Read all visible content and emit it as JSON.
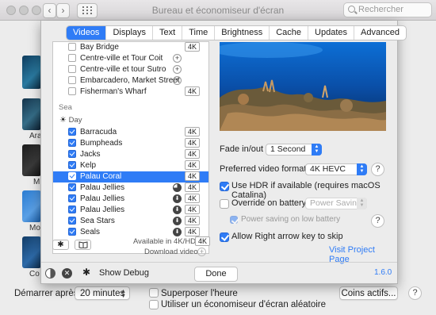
{
  "window": {
    "title": "Bureau et économiseur d'écran",
    "search_placeholder": "Rechercher"
  },
  "background": {
    "labels": [
      "Ara",
      "M",
      "Mo",
      "Co"
    ],
    "start_after_label": "Démarrer après",
    "start_after_value": "20 minutes",
    "show_clock_label": "Superposer l'heure",
    "random_label": "Utiliser un économiseur d'écran aléatoire",
    "hot_corners_label": "Coins actifs...",
    "help": "?"
  },
  "sheet": {
    "tabs": [
      {
        "label": "Videos",
        "active": true
      },
      {
        "label": "Displays",
        "active": false
      },
      {
        "label": "Text",
        "active": false
      },
      {
        "label": "Time",
        "active": false
      },
      {
        "label": "Brightness",
        "active": false
      },
      {
        "label": "Cache",
        "active": false
      },
      {
        "label": "Updates",
        "active": false
      },
      {
        "label": "Advanced",
        "active": false
      }
    ],
    "list": {
      "top_items": [
        {
          "name": "Bay Bridge",
          "checked": false,
          "badge": "4K",
          "icon": null
        },
        {
          "name": "Centre-ville et Tour Coit",
          "checked": false,
          "badge": null,
          "icon": "plus"
        },
        {
          "name": "Centre-ville et tour Sutro",
          "checked": false,
          "badge": null,
          "icon": "plus"
        },
        {
          "name": "Embarcadero, Market Street",
          "checked": false,
          "badge": null,
          "icon": "plus"
        },
        {
          "name": "Fisherman's Wharf",
          "checked": false,
          "badge": "4K",
          "icon": null
        }
      ],
      "section_sea": "Sea",
      "section_day": "Day",
      "sea_items": [
        {
          "name": "Barracuda",
          "checked": true,
          "badge": "4K",
          "icon": null,
          "selected": false
        },
        {
          "name": "Bumpheads",
          "checked": true,
          "badge": "4K",
          "icon": null,
          "selected": false
        },
        {
          "name": "Jacks",
          "checked": true,
          "badge": "4K",
          "icon": null,
          "selected": false
        },
        {
          "name": "Kelp",
          "checked": true,
          "badge": "4K",
          "icon": null,
          "selected": false
        },
        {
          "name": "Palau Coral",
          "checked": true,
          "badge": "4K",
          "icon": null,
          "selected": true
        },
        {
          "name": "Palau Jellies",
          "checked": true,
          "badge": "4K",
          "icon": "pie",
          "selected": false
        },
        {
          "name": "Palau Jellies",
          "checked": true,
          "badge": "4K",
          "icon": "download",
          "selected": false
        },
        {
          "name": "Palau Jellies",
          "checked": true,
          "badge": "4K",
          "icon": "download",
          "selected": false
        },
        {
          "name": "Sea Stars",
          "checked": true,
          "badge": "4K",
          "icon": "download",
          "selected": false
        },
        {
          "name": "Seals",
          "checked": true,
          "badge": "4K",
          "icon": "download",
          "selected": false
        }
      ]
    },
    "available_label": "Available in 4K/HDR",
    "available_badge": "4K",
    "download_label": "Download video",
    "fade_label": "Fade in/out",
    "fade_value": "1 Second",
    "format_label": "Preferred video format",
    "format_value": "4K HEVC",
    "hdr_label": "Use HDR if available (requires macOS Catalina)",
    "battery_label": "Override on battery",
    "battery_value": "Power Saving",
    "power_saving_label": "Power saving on low battery",
    "skip_label": "Allow Right arrow key to skip",
    "project_link": "Visit Project Page",
    "show_debug_label": "Show Debug",
    "done_label": "Done",
    "version": "1.6.0",
    "help": "?"
  },
  "colors": {
    "accent": "#2f7cf6",
    "link": "#2f7cf6"
  }
}
